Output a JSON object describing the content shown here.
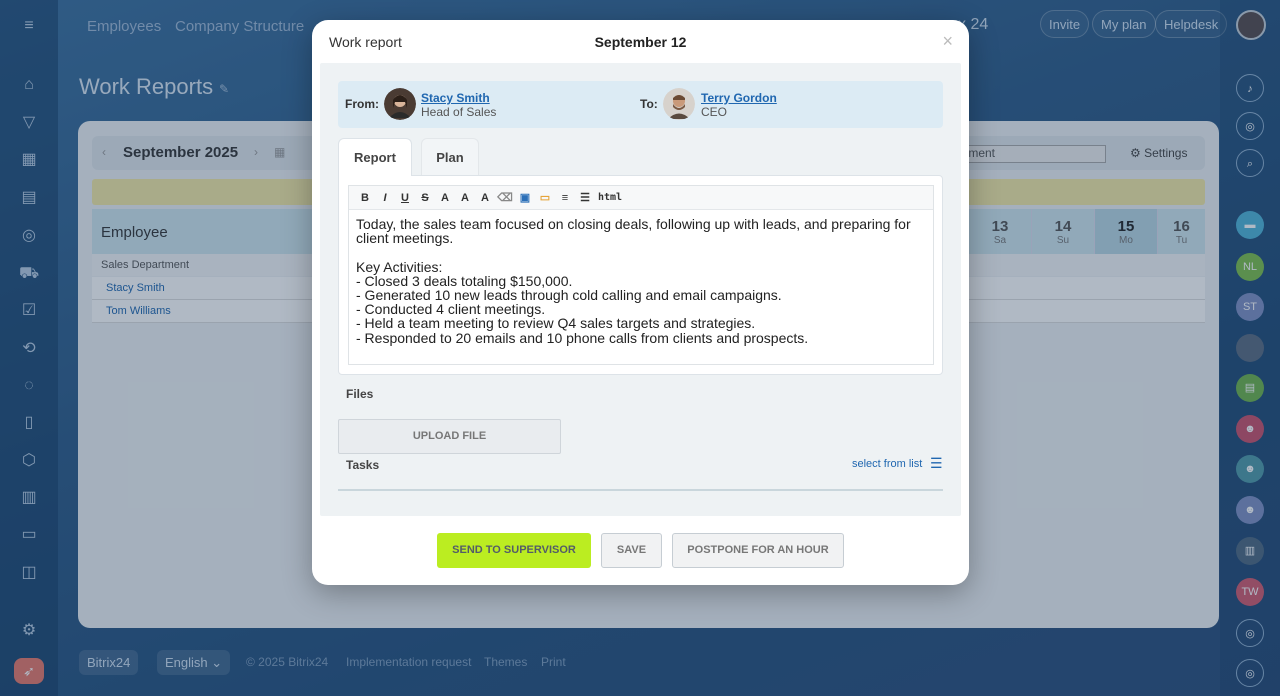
{
  "top_nav": {
    "items": [
      "Employees",
      "Company Structure"
    ],
    "brand": "x 24",
    "pills": [
      "Invite",
      "My plan",
      "Helpdesk"
    ]
  },
  "page": {
    "title": "Work Reports"
  },
  "background_grid": {
    "month": "September 2025",
    "filter_value": "rtment",
    "settings_label": "Settings",
    "employee_header": "Employee",
    "days": [
      {
        "num": "13",
        "dn": "Sa"
      },
      {
        "num": "14",
        "dn": "Su"
      },
      {
        "num": "15",
        "dn": "Mo"
      },
      {
        "num": "16",
        "dn": "Tu"
      }
    ],
    "department": "Sales Department",
    "rows": [
      "Stacy Smith",
      "Tom Williams"
    ]
  },
  "footer": {
    "brand": "Bitrix24",
    "language": "English",
    "copyright": "© 2025 Bitrix24",
    "links": [
      "Implementation request",
      "Themes",
      "Print"
    ]
  },
  "right_bar": {
    "initials": [
      "NL",
      "ST",
      "TW"
    ]
  },
  "modal": {
    "title": "Work report",
    "date": "September 12",
    "close": "×",
    "from_label": "From:",
    "from_name": "Stacy Smith",
    "from_role": "Head of Sales",
    "to_label": "To:",
    "to_name": "Terry Gordon",
    "to_role": "CEO",
    "tabs": [
      "Report",
      "Plan"
    ],
    "toolbar": [
      "B",
      "I",
      "U",
      "S",
      "A",
      "A",
      "A",
      "⌫",
      "▣",
      "▭",
      "≡",
      "☰",
      "html"
    ],
    "report_text": "Today, the sales team focused on closing deals, following up with leads, and preparing for client meetings.\n\nKey Activities:\n- Closed 3 deals totaling $150,000.\n- Generated 10 new leads through cold calling and email campaigns.\n- Conducted 4 client meetings.\n- Held a team meeting to review Q4 sales targets and strategies.\n- Responded to 20 emails and 10 phone calls from clients and prospects.",
    "files_label": "Files",
    "upload_label": "UPLOAD FILE",
    "tasks_label": "Tasks",
    "select_from_list": "select from list",
    "buttons": {
      "send": "SEND TO SUPERVISOR",
      "save": "SAVE",
      "postpone": "POSTPONE FOR AN HOUR"
    }
  },
  "colors": {
    "accent_green": "#bbed21",
    "link_blue": "#2067b0"
  }
}
